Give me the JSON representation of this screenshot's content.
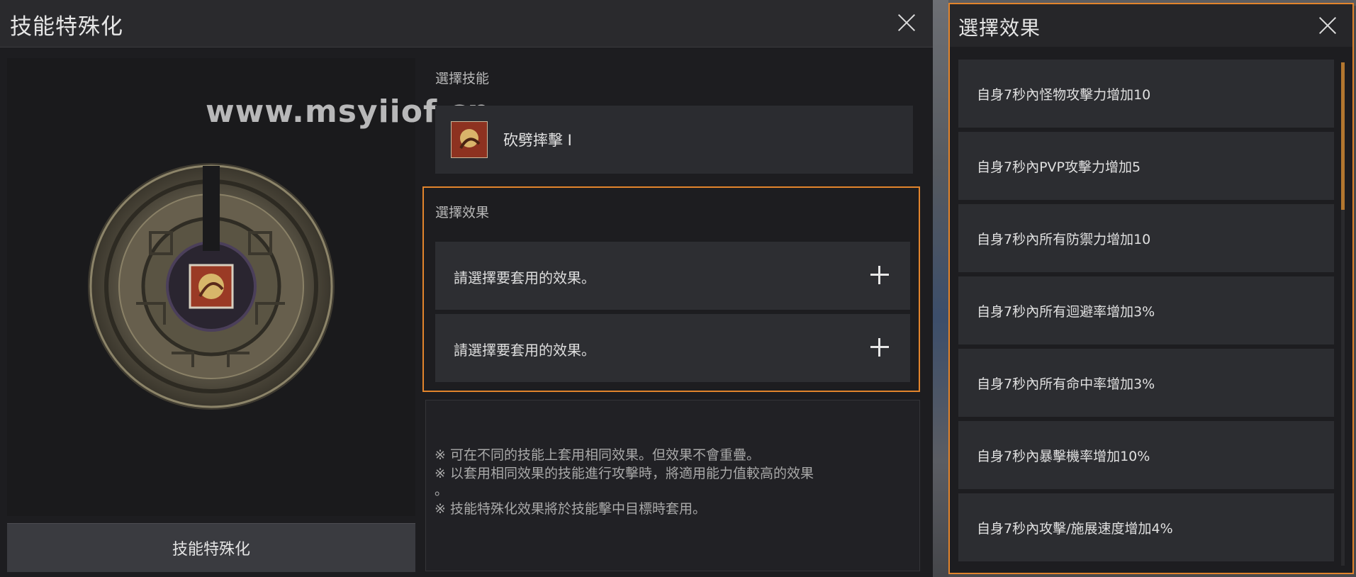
{
  "main": {
    "title": "技能特殊化",
    "watermark": "www.msyiiof.cn",
    "spec_button": "技能特殊化",
    "skill_section_label": "選擇技能",
    "skill_name": "砍劈摔擊 I",
    "effect_section_label": "選擇效果",
    "effect_slots": [
      {
        "text": "請選擇要套用的效果。"
      },
      {
        "text": "請選擇要套用的效果。"
      }
    ],
    "notes": [
      "※ 可在不同的技能上套用相同效果。但效果不會重疊。",
      "※ 以套用相同效果的技能進行攻擊時，將適用能力值較高的效果",
      "。",
      "※ 技能特殊化效果將於技能擊中目標時套用。"
    ]
  },
  "select_panel": {
    "title": "選擇效果",
    "options": [
      {
        "text": "自身7秒內怪物攻擊力增加10"
      },
      {
        "text": "自身7秒內PVP攻擊力增加5"
      },
      {
        "text": "自身7秒內所有防禦力增加10"
      },
      {
        "text": "自身7秒內所有迴避率增加3%"
      },
      {
        "text": "自身7秒內所有命中率增加3%"
      },
      {
        "text": "自身7秒內暴擊機率增加10%"
      },
      {
        "text": "自身7秒內攻擊/施展速度增加4%"
      }
    ],
    "scroll_position": 0.0
  },
  "colors": {
    "accent": "#e2842c",
    "panel": "#1d1d20",
    "row": "#2c2d31"
  },
  "icons": [
    "close-icon",
    "plus-icon",
    "skill-icon"
  ]
}
